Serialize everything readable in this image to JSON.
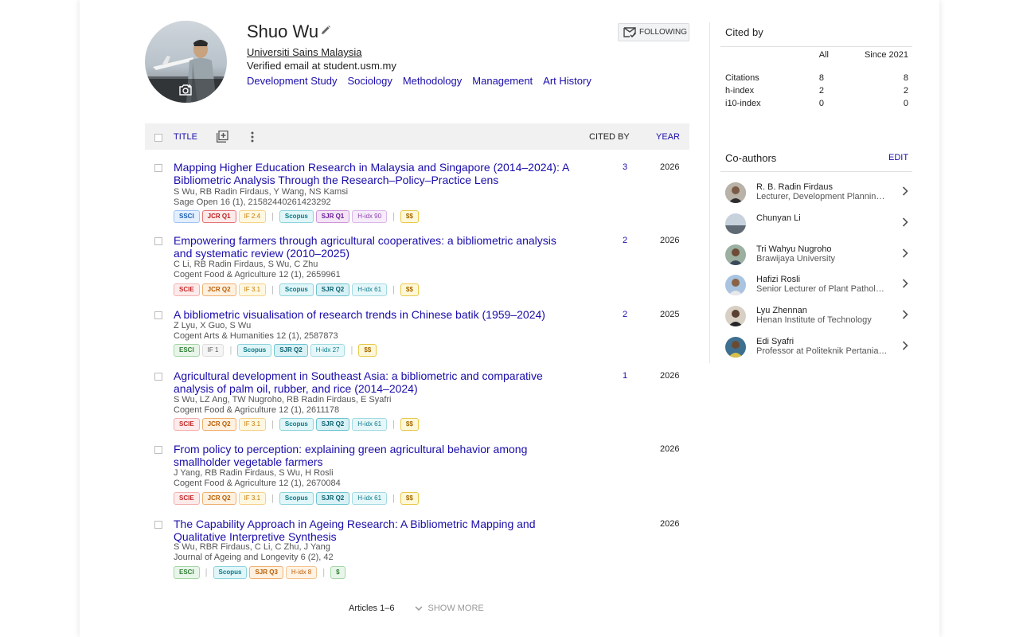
{
  "profile": {
    "name": "Shuo Wu",
    "affiliation": "Universiti Sains Malaysia",
    "email": "Verified email at student.usm.my",
    "interests": [
      "Development Study",
      "Sociology",
      "Methodology",
      "Management",
      "Art History"
    ],
    "follow_label": "FOLLOWING"
  },
  "table": {
    "title_label": "TITLE",
    "cited_by_label": "CITED BY",
    "year_label": "YEAR"
  },
  "articles": [
    {
      "title": "Mapping Higher Education Research in Malaysia and Singapore (2014–2024): A Bibliometric Analysis Through the Research–Policy–Practice Lens",
      "authors": "S Wu, RB Radin Firdaus, Y Wang, NS Kamsi",
      "venue": "Sage Open 16 (1), 21582440261423292",
      "cited": "3",
      "year": "2026",
      "badges": [
        "SSCI",
        "JCR Q1",
        "IF 2.4",
        "Scopus",
        "SJR Q1",
        "H-idx 90",
        "$$"
      ]
    },
    {
      "title": "Empowering farmers through agricultural cooperatives: a bibliometric analysis and systematic review (2010–2025)",
      "authors": "C Li, RB Radin Firdaus, S Wu, C Zhu",
      "venue": "Cogent Food & Agriculture 12 (1), 2659961",
      "cited": "2",
      "year": "2026",
      "badges": [
        "SCIE",
        "JCR Q2",
        "IF 3.1",
        "Scopus",
        "SJR Q2",
        "H-idx 61",
        "$$"
      ]
    },
    {
      "title": "A bibliometric visualisation of research trends in Chinese batik (1959–2024)",
      "authors": "Z Lyu, X Guo, S Wu",
      "venue": "Cogent Arts & Humanities 12 (1), 2587873",
      "cited": "2",
      "year": "2025",
      "badges": [
        "ESCI",
        "IF 1",
        "Scopus",
        "SJR Q2",
        "H-idx 27",
        "$$"
      ]
    },
    {
      "title": "Agricultural development in Southeast Asia: a bibliometric and comparative analysis of palm oil, rubber, and rice (2014–2024)",
      "authors": "S Wu, LZ Ang, TW Nugroho, RB Radin Firdaus, E Syafri",
      "venue": "Cogent Food & Agriculture 12 (1), 2611178",
      "cited": "1",
      "year": "2026",
      "badges": [
        "SCIE",
        "JCR Q2",
        "IF 3.1",
        "Scopus",
        "SJR Q2",
        "H-idx 61",
        "$$"
      ]
    },
    {
      "title": "From policy to perception: explaining green agricultural behavior among smallholder vegetable farmers",
      "authors": "J Yang, RB Radin Firdaus, S Wu, H Rosli",
      "venue": "Cogent Food & Agriculture 12 (1), 2670084",
      "cited": "",
      "year": "2026",
      "badges": [
        "SCIE",
        "JCR Q2",
        "IF 3.1",
        "Scopus",
        "SJR Q2",
        "H-idx 61",
        "$$"
      ]
    },
    {
      "title": "The Capability Approach in Ageing Research: A Bibliometric Mapping and Qualitative Interpretive Synthesis",
      "authors": "S Wu, RBR Firdaus, C Li, C Zhu, J Yang",
      "venue": "Journal of Ageing and Longevity 6 (2), 42",
      "cited": "",
      "year": "2026",
      "badges": [
        "ESCI",
        "Scopus",
        "SJR Q3",
        "H-idx 8",
        "$"
      ]
    }
  ],
  "footer": {
    "articles_count": "Articles 1–6",
    "show_more": "SHOW MORE"
  },
  "cited_by": {
    "title": "Cited by",
    "col_all": "All",
    "col_since": "Since 2021",
    "rows": [
      {
        "label": "Citations",
        "all": "8",
        "since": "8"
      },
      {
        "label": "h-index",
        "all": "2",
        "since": "2"
      },
      {
        "label": "i10-index",
        "all": "0",
        "since": "0"
      }
    ]
  },
  "coauthors": {
    "title": "Co-authors",
    "edit_label": "EDIT",
    "items": [
      {
        "name": "R. B. Radin Firdaus",
        "affiliation": "Lecturer, Development Planning and Management"
      },
      {
        "name": "Chunyan Li",
        "affiliation": ""
      },
      {
        "name": "Tri Wahyu Nugroho",
        "affiliation": "Brawijaya University"
      },
      {
        "name": "Hafizi Rosli",
        "affiliation": "Senior Lecturer of Plant Pathology"
      },
      {
        "name": "Lyu Zhennan",
        "affiliation": "Henan Institute of Technology"
      },
      {
        "name": "Edi Syafri",
        "affiliation": "Professor at Politeknik Pertanian Negeri Payakumbuh"
      }
    ]
  },
  "colors": {
    "link": "#1a0dab",
    "header_bg": "#f1f1f1"
  }
}
